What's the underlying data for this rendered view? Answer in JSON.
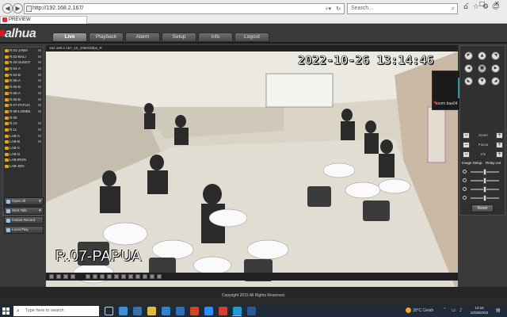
{
  "browser": {
    "url": "http://192.168.2.167/",
    "search_placeholder": "Search...",
    "tab_title": "PREVIEW"
  },
  "app": {
    "logo": "alhua",
    "menu": [
      "Live",
      "Playback",
      "Alarm",
      "Setup",
      "Info",
      "Logout"
    ],
    "active_menu": "Live"
  },
  "channels": [
    {
      "label": "R.01-JAWA",
      "mark": "M"
    },
    {
      "label": "R.02-BALI",
      "mark": "M"
    },
    {
      "label": "R.03-SUMAT",
      "mark": "M"
    },
    {
      "label": "R.04-A",
      "mark": "M"
    },
    {
      "label": "R.04-B",
      "mark": "M"
    },
    {
      "label": "R.05-A",
      "mark": "M"
    },
    {
      "label": "R.05-B",
      "mark": "M"
    },
    {
      "label": "R.06-A",
      "mark": "M"
    },
    {
      "label": "R.06-B",
      "mark": "M"
    },
    {
      "label": "R.07-PAPUA",
      "mark": "M"
    },
    {
      "label": "R.08-LOMBK",
      "mark": "M"
    },
    {
      "label": "R.09",
      "mark": ""
    },
    {
      "label": "R.10",
      "mark": "M"
    },
    {
      "label": "R.11",
      "mark": "M"
    },
    {
      "label": "LAB-A",
      "mark": "M"
    },
    {
      "label": "LAB-B",
      "mark": "M"
    },
    {
      "label": "LAB-C",
      "mark": ""
    },
    {
      "label": "LAB-D",
      "mark": ""
    },
    {
      "label": "LAB-IRGN",
      "mark": ""
    },
    {
      "label": "LAB-JEN",
      "mark": ""
    }
  ],
  "left_buttons": [
    "Open All",
    "Start Talk",
    "Instant Record",
    "Local Play"
  ],
  "video": {
    "title": "192.168.2.167_10_1080/30fps_R",
    "timestamp": "2022-10-26 13:14:46",
    "camera_name": "R.07-PAPUA"
  },
  "zoom": {
    "avatar_letter": "Z",
    "name": "zoom baa04"
  },
  "ptz": {
    "zoom_label": "Zoom",
    "focus_label": "Focus",
    "iris_label": "Iris",
    "image_setup": "Image Setup",
    "relay_out": "Relay-out",
    "reset": "Reset"
  },
  "footer": {
    "copyright": "Copyright 2015 All Rights Reserved."
  },
  "taskbar": {
    "search_placeholder": "Type here to search",
    "weather": "30°C  Cerah",
    "time": "13:15",
    "date": "10/26/2022"
  },
  "colors": {
    "brand_red": "#d81b1b",
    "zoom_teal": "#1c9aa8",
    "channel_icon": "#d9a326"
  }
}
